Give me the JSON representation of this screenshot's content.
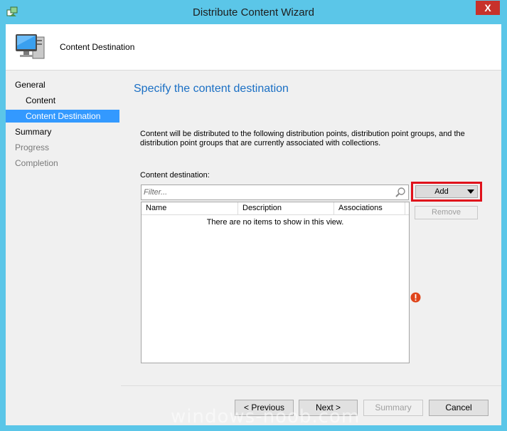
{
  "window": {
    "title": "Distribute Content Wizard",
    "close_label": "X"
  },
  "header": {
    "title": "Content Destination"
  },
  "nav": {
    "items": [
      {
        "label": "General"
      },
      {
        "label": "Content"
      },
      {
        "label": "Content Destination"
      },
      {
        "label": "Summary"
      },
      {
        "label": "Progress"
      },
      {
        "label": "Completion"
      }
    ]
  },
  "main": {
    "heading": "Specify the content destination",
    "description": "Content will be distributed to the following distribution points, distribution point groups, and the distribution point groups that are currently associated with collections.",
    "destination_label": "Content destination:",
    "filter_placeholder": "Filter...",
    "columns": [
      "Name",
      "Description",
      "Associations"
    ],
    "empty_message": "There are no items to show in this view.",
    "add_label": "Add",
    "remove_label": "Remove"
  },
  "footer": {
    "previous_label": "< Previous",
    "next_label": "Next >",
    "summary_label": "Summary",
    "cancel_label": "Cancel"
  },
  "watermark": "windows-noob.com",
  "colors": {
    "titlebar": "#5bc6e8",
    "selection": "#3399ff",
    "heading": "#1a6fc4",
    "highlight_frame": "#e0121b",
    "close": "#c7312b"
  },
  "icons": {
    "app": "wizard-app-icon",
    "header": "computer-monitor-icon",
    "search": "magnifier-icon",
    "error": "error-icon",
    "dropdown": "dropdown-arrow-icon"
  }
}
